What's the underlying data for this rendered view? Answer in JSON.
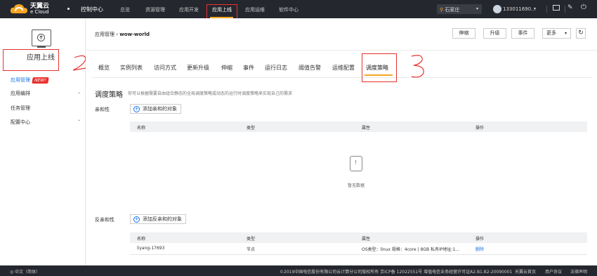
{
  "topbar": {
    "logo_cn": "天翼云",
    "logo_en": "e Cloud",
    "console": "控制中心",
    "nav": [
      "总览",
      "资源管理",
      "应用开发",
      "应用上线",
      "应用运维",
      "软件中心"
    ],
    "region": "石家庄",
    "user": "133011690..."
  },
  "sidebar": {
    "title": "应用上线",
    "items": [
      "应用管理",
      "应用编排",
      "任务管理",
      "配置中心"
    ],
    "new_badge": "NEW!"
  },
  "header": {
    "breadcrumb_parent": "应用管理",
    "breadcrumb_sep": "›",
    "breadcrumb_current": "wow-world",
    "buttons": [
      "伸缩",
      "升级",
      "事件",
      "更多"
    ]
  },
  "tabs": [
    "概览",
    "实例列表",
    "访问方式",
    "更新升级",
    "伸缩",
    "事件",
    "运行日志",
    "阈值告警",
    "运维配置",
    "调度策略"
  ],
  "policy": {
    "title": "调度策略",
    "desc": "你可以根据需要自由组合静态的全局调度策略或动态的运行时调度策略来实现自己的需求",
    "affinity": {
      "label": "亲和性",
      "add": "添加亲和的对象",
      "columns": [
        "名称",
        "类型",
        "属性",
        "操作"
      ],
      "empty": "暂无数据"
    },
    "anti_affinity": {
      "label": "反亲和性",
      "add": "添加反亲和的对象",
      "columns": [
        "名称",
        "类型",
        "属性",
        "操作"
      ],
      "rows": [
        {
          "name": "liyang-17693",
          "type": "节点",
          "attr": "OS类型：linux 规格：4core | 8GB 私有IP地址:1...",
          "action": "删除"
        }
      ]
    }
  },
  "footer": {
    "lang": "中文（简体）",
    "copyright": "©2019中国电信股份有限公司云计算分公司版权所有  京ICP备 12022551号  增值电信业务经营许可证A2.B1.B2-20090001",
    "links": [
      "天翼云首页",
      "用户协议",
      "法律声明"
    ]
  },
  "colors": {
    "accent": "#f5a623",
    "link": "#1a73e8",
    "annotation": "#e8312f",
    "topbar": "#25272e"
  }
}
